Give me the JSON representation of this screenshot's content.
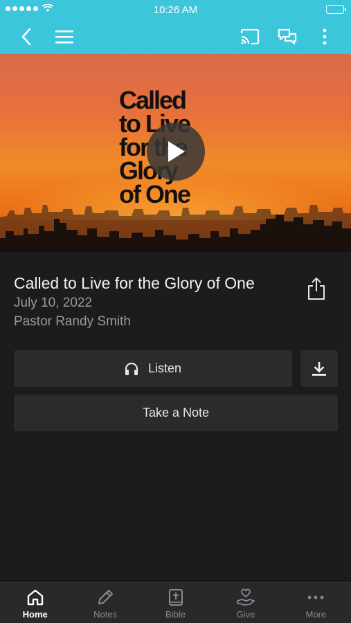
{
  "status_bar": {
    "time": "10:26 AM"
  },
  "colors": {
    "accent": "#3cc6dc",
    "background": "#1c1c1e",
    "button": "#2b2b2d"
  },
  "nav": {
    "back_icon": "chevron-left-icon",
    "menu_icon": "hamburger-menu-icon",
    "cast_icon": "cast-icon",
    "chat_icon": "chat-bubbles-icon",
    "more_icon": "vertical-ellipsis-icon"
  },
  "hero": {
    "artwork_title": "Called\nto Live\nfor the\nGlory\nof One"
  },
  "sermon": {
    "title": "Called to Live for the Glory of One",
    "date": "July 10, 2022",
    "pastor": "Pastor Randy Smith"
  },
  "actions": {
    "listen_label": "Listen",
    "take_note_label": "Take a Note"
  },
  "tabs": [
    {
      "label": "Home",
      "icon": "home-icon",
      "active": true
    },
    {
      "label": "Notes",
      "icon": "pencil-icon",
      "active": false
    },
    {
      "label": "Bible",
      "icon": "bible-icon",
      "active": false
    },
    {
      "label": "Give",
      "icon": "give-hand-heart-icon",
      "active": false
    },
    {
      "label": "More",
      "icon": "horizontal-ellipsis-icon",
      "active": false
    }
  ]
}
